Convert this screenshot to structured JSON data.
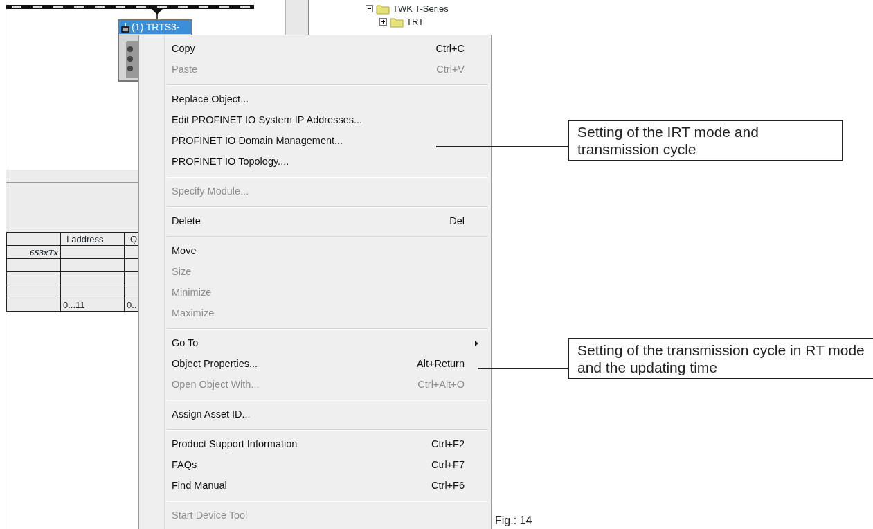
{
  "diagram": {
    "device": {
      "title": "(1) TRTS3-",
      "selected": true
    }
  },
  "catalog_tree": [
    {
      "label": "TWK T-Series",
      "expanded": true,
      "children": [
        {
          "label": "TRT",
          "expanded": false
        }
      ]
    }
  ],
  "table": {
    "columns": [
      "I address",
      "Q"
    ],
    "rows": [
      {
        "column_1": "6S3xTx"
      },
      {},
      {},
      {},
      {
        "i_address": "0...11",
        "q": "0.."
      }
    ]
  },
  "context_menu": {
    "groups": [
      [
        {
          "label": "Copy",
          "shortcut": "Ctrl+C",
          "disabled": false,
          "submenu": false
        },
        {
          "label": "Paste",
          "shortcut": "Ctrl+V",
          "disabled": true,
          "submenu": false
        }
      ],
      [
        {
          "label": "Replace Object...",
          "disabled": false,
          "submenu": false
        },
        {
          "label": "Edit PROFINET IO System IP Addresses...",
          "disabled": false,
          "submenu": false
        },
        {
          "label": "PROFINET IO Domain Management...",
          "disabled": false,
          "submenu": false
        },
        {
          "label": "PROFINET IO Topology....",
          "disabled": false,
          "submenu": false
        }
      ],
      [
        {
          "label": "Specify Module...",
          "disabled": true,
          "submenu": false
        }
      ],
      [
        {
          "label": "Delete",
          "shortcut": "Del",
          "disabled": false,
          "submenu": false
        }
      ],
      [
        {
          "label": "Move",
          "disabled": false,
          "submenu": false
        },
        {
          "label": "Size",
          "disabled": true,
          "submenu": false
        },
        {
          "label": "Minimize",
          "disabled": true,
          "submenu": false
        },
        {
          "label": "Maximize",
          "disabled": true,
          "submenu": false
        }
      ],
      [
        {
          "label": "Go To",
          "disabled": false,
          "submenu": true
        },
        {
          "label": "Object Properties...",
          "shortcut": "Alt+Return",
          "disabled": false,
          "submenu": false
        },
        {
          "label": "Open Object With...",
          "shortcut": "Ctrl+Alt+O",
          "disabled": true,
          "submenu": false
        }
      ],
      [
        {
          "label": "Assign Asset ID...",
          "disabled": false,
          "submenu": false
        }
      ],
      [
        {
          "label": "Product Support Information",
          "shortcut": "Ctrl+F2",
          "disabled": false,
          "submenu": false
        },
        {
          "label": "FAQs",
          "shortcut": "Ctrl+F7",
          "disabled": false,
          "submenu": false
        },
        {
          "label": "Find Manual",
          "shortcut": "Ctrl+F6",
          "disabled": false,
          "submenu": false
        }
      ],
      [
        {
          "label": "Start Device Tool",
          "disabled": true,
          "submenu": false
        }
      ]
    ]
  },
  "callouts": [
    {
      "text": "Setting of the IRT mode and transmission cycle"
    },
    {
      "text": "Setting of the transmission cycle in RT mode and the updating time"
    }
  ],
  "figure_label": "Fig.: 14"
}
